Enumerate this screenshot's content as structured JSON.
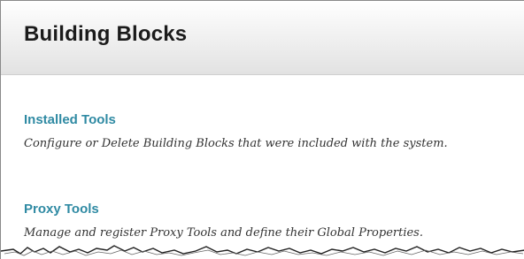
{
  "page": {
    "title": "Building Blocks"
  },
  "items": [
    {
      "label": "Installed Tools",
      "description": "Configure or Delete Building Blocks that were included with the system."
    },
    {
      "label": "Proxy Tools",
      "description": "Manage and register Proxy Tools and define their Global Properties."
    }
  ],
  "colors": {
    "link": "#2f8aa3",
    "title": "#1b1b1b",
    "header_gradient_bottom": "#e2e2e2"
  }
}
